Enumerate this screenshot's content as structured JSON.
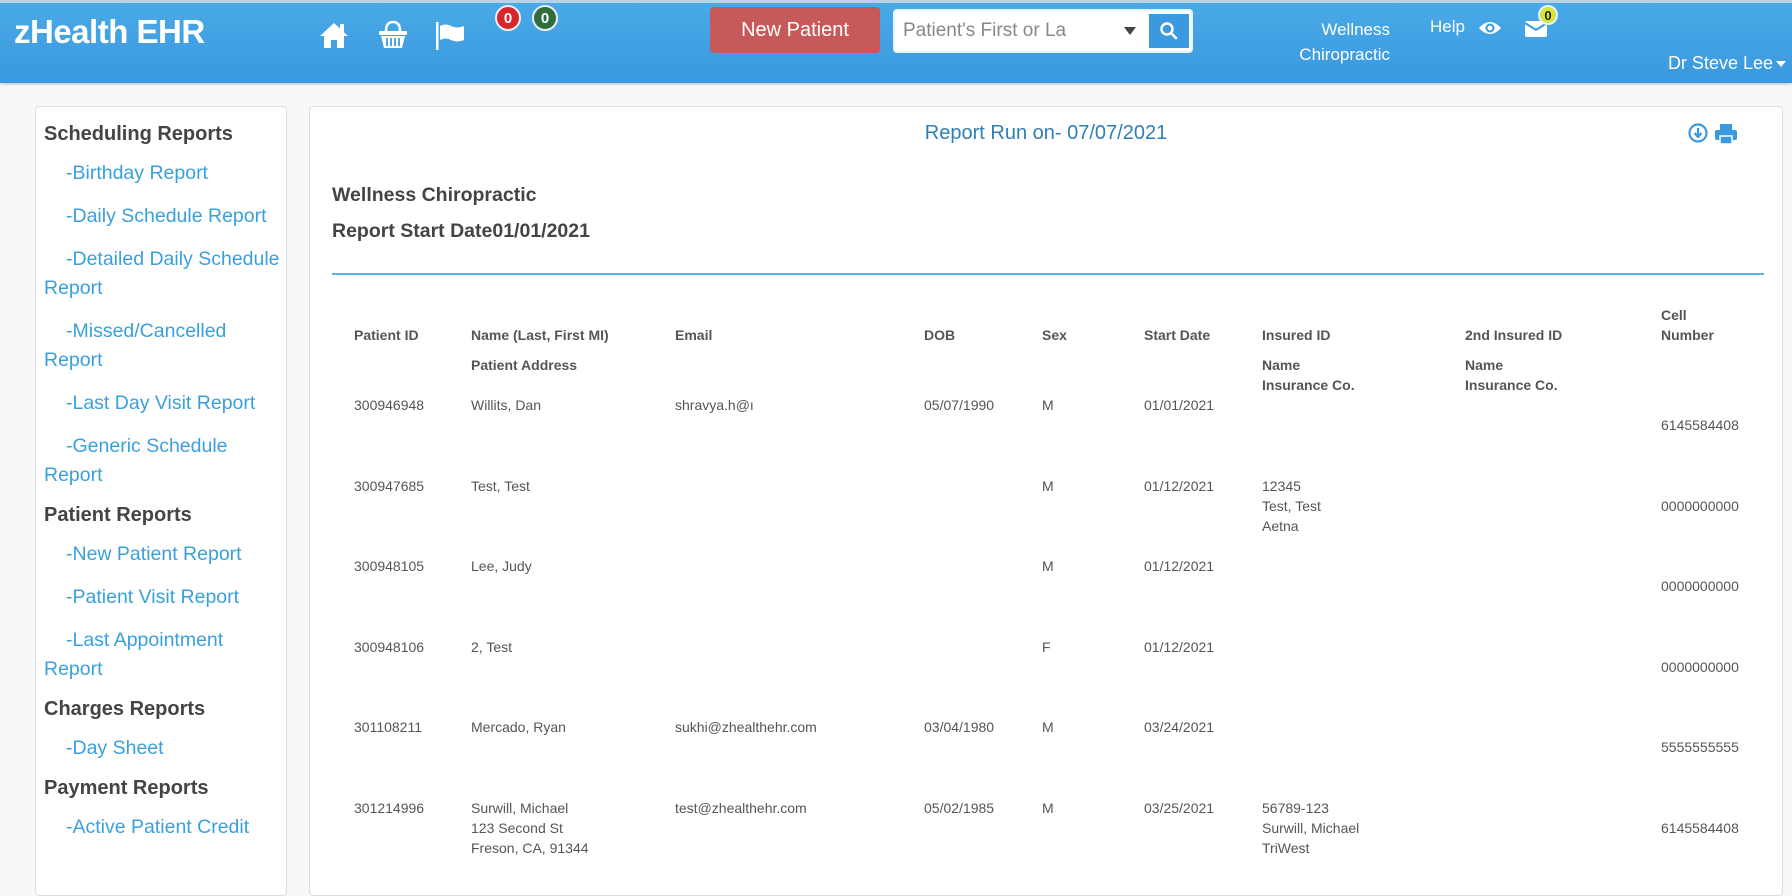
{
  "header": {
    "brand": "zHealth EHR",
    "nav_icons": [
      "home-icon",
      "basket-icon",
      "flag-icon"
    ],
    "badges": [
      {
        "value": "0",
        "color": "#d9262b"
      },
      {
        "value": "0",
        "color": "#2f6d3c"
      }
    ],
    "new_patient_label": "New Patient",
    "search": {
      "placeholder": "Patient's First or La",
      "value": ""
    },
    "clinic_line1": "Wellness",
    "clinic_line2": "Chiropractic",
    "help_label": "Help",
    "mail_badge": "0",
    "user_label": "Dr Steve Lee"
  },
  "sidebar": {
    "sections": [
      {
        "title": "Scheduling Reports",
        "items": [
          "-Birthday Report",
          "-Daily Schedule Report",
          "-Detailed Daily Schedule Report",
          "-Missed/Cancelled Report",
          "-Last Day Visit Report",
          "-Generic Schedule Report"
        ]
      },
      {
        "title": "Patient Reports",
        "items": [
          "-New Patient Report",
          "-Patient Visit Report",
          "-Last Appointment Report"
        ]
      },
      {
        "title": "Charges Reports",
        "items": [
          "-Day Sheet"
        ]
      },
      {
        "title": "Payment Reports",
        "items": [
          "-Active Patient Credit"
        ]
      }
    ]
  },
  "report": {
    "run_on": "Report Run on- 07/07/2021",
    "organization": "Wellness Chiropractic",
    "start_date": "Report Start Date01/01/2021",
    "accent_color": "#3aa0dc",
    "columns": {
      "patient_id": "Patient ID",
      "name": "Name (Last, First MI)",
      "address": "Patient Address",
      "email": "Email",
      "dob": "DOB",
      "sex": "Sex",
      "start_date": "Start Date",
      "insured_id": "Insured ID",
      "insured_name": "Name",
      "insured_co": "Insurance Co.",
      "insured2_id": "2nd Insured ID",
      "insured2_name": "Name",
      "insured2_co": "Insurance Co.",
      "cell_1": "Cell",
      "cell_2": "Number"
    },
    "rows": [
      {
        "patient_id": "300946948",
        "name": "Willits, Dan",
        "address": [
          "",
          ""
        ],
        "email": "shravya.h@ı",
        "dob": "05/07/1990",
        "sex": "M",
        "start_date": "01/01/2021",
        "insured": [
          "",
          "",
          ""
        ],
        "insured2": [
          "",
          "",
          ""
        ],
        "cell": "6145584408"
      },
      {
        "patient_id": "300947685",
        "name": "Test, Test",
        "address": [
          "",
          ""
        ],
        "email": "",
        "dob": "",
        "sex": "M",
        "start_date": "01/12/2021",
        "insured": [
          "12345",
          "Test, Test",
          "Aetna"
        ],
        "insured2": [
          "",
          "",
          ""
        ],
        "cell": "0000000000"
      },
      {
        "patient_id": "300948105",
        "name": "Lee, Judy",
        "address": [
          "",
          ""
        ],
        "email": "",
        "dob": "",
        "sex": "M",
        "start_date": "01/12/2021",
        "insured": [
          "",
          "",
          ""
        ],
        "insured2": [
          "",
          "",
          ""
        ],
        "cell": "0000000000"
      },
      {
        "patient_id": "300948106",
        "name": "2, Test",
        "address": [
          "",
          ""
        ],
        "email": "",
        "dob": "",
        "sex": "F",
        "start_date": "01/12/2021",
        "insured": [
          "",
          "",
          ""
        ],
        "insured2": [
          "",
          "",
          ""
        ],
        "cell": "0000000000"
      },
      {
        "patient_id": "301108211",
        "name": "Mercado, Ryan",
        "address": [
          "",
          ""
        ],
        "email": "sukhi@zhealthehr.com",
        "dob": "03/04/1980",
        "sex": "M",
        "start_date": "03/24/2021",
        "insured": [
          "",
          "",
          ""
        ],
        "insured2": [
          "",
          "",
          ""
        ],
        "cell": "5555555555"
      },
      {
        "patient_id": "301214996",
        "name": "Surwill, Michael",
        "address": [
          "123 Second St",
          "Freson, CA, 91344"
        ],
        "email": "test@zhealthehr.com",
        "dob": "05/02/1985",
        "sex": "M",
        "start_date": "03/25/2021",
        "insured": [
          "56789-123",
          "Surwill, Michael",
          "TriWest"
        ],
        "insured2": [
          "",
          "",
          ""
        ],
        "cell": "6145584408"
      }
    ]
  }
}
